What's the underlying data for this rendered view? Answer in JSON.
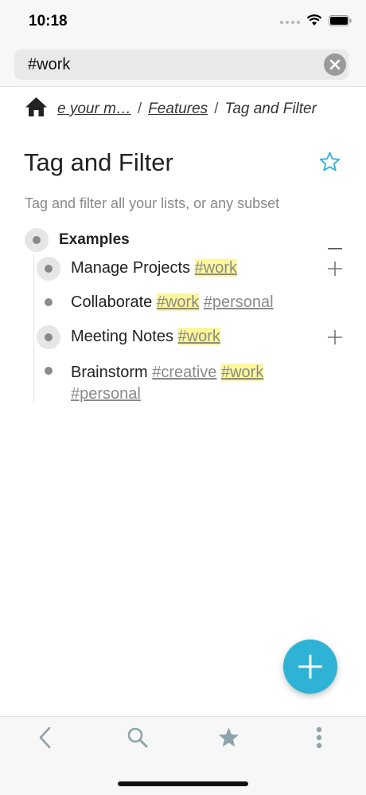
{
  "status": {
    "time": "10:18"
  },
  "search": {
    "value": "#work",
    "placeholder": "Search"
  },
  "breadcrumb": {
    "items": [
      "e your m…",
      "Features",
      "Tag and Filter"
    ],
    "separator": "/"
  },
  "page": {
    "title": "Tag and Filter",
    "subtitle": "Tag and filter all your lists, or any subset"
  },
  "list": {
    "parent": {
      "label": "Examples"
    },
    "items": [
      {
        "label": "Manage Projects",
        "tags": [
          "#work"
        ]
      },
      {
        "label": "Collaborate",
        "tags": [
          "#work",
          "#personal"
        ]
      },
      {
        "label": "Meeting Notes",
        "tags": [
          "#work"
        ]
      },
      {
        "label": "Brainstorm",
        "tags": [
          "#creative",
          "#work",
          "#personal"
        ]
      }
    ]
  },
  "icons": {
    "home": "home-icon",
    "star": "star-outline-icon",
    "clear": "clear-icon",
    "collapse": "minus-icon",
    "expand": "plus-icon",
    "add": "plus-icon",
    "back": "chevron-left-icon",
    "search": "search-icon",
    "favorites": "star-icon",
    "more": "more-vertical-icon"
  },
  "colors": {
    "accent": "#2eb2d6",
    "tag_highlight": "#fdf79a",
    "tag_text": "#8a8a8a"
  }
}
